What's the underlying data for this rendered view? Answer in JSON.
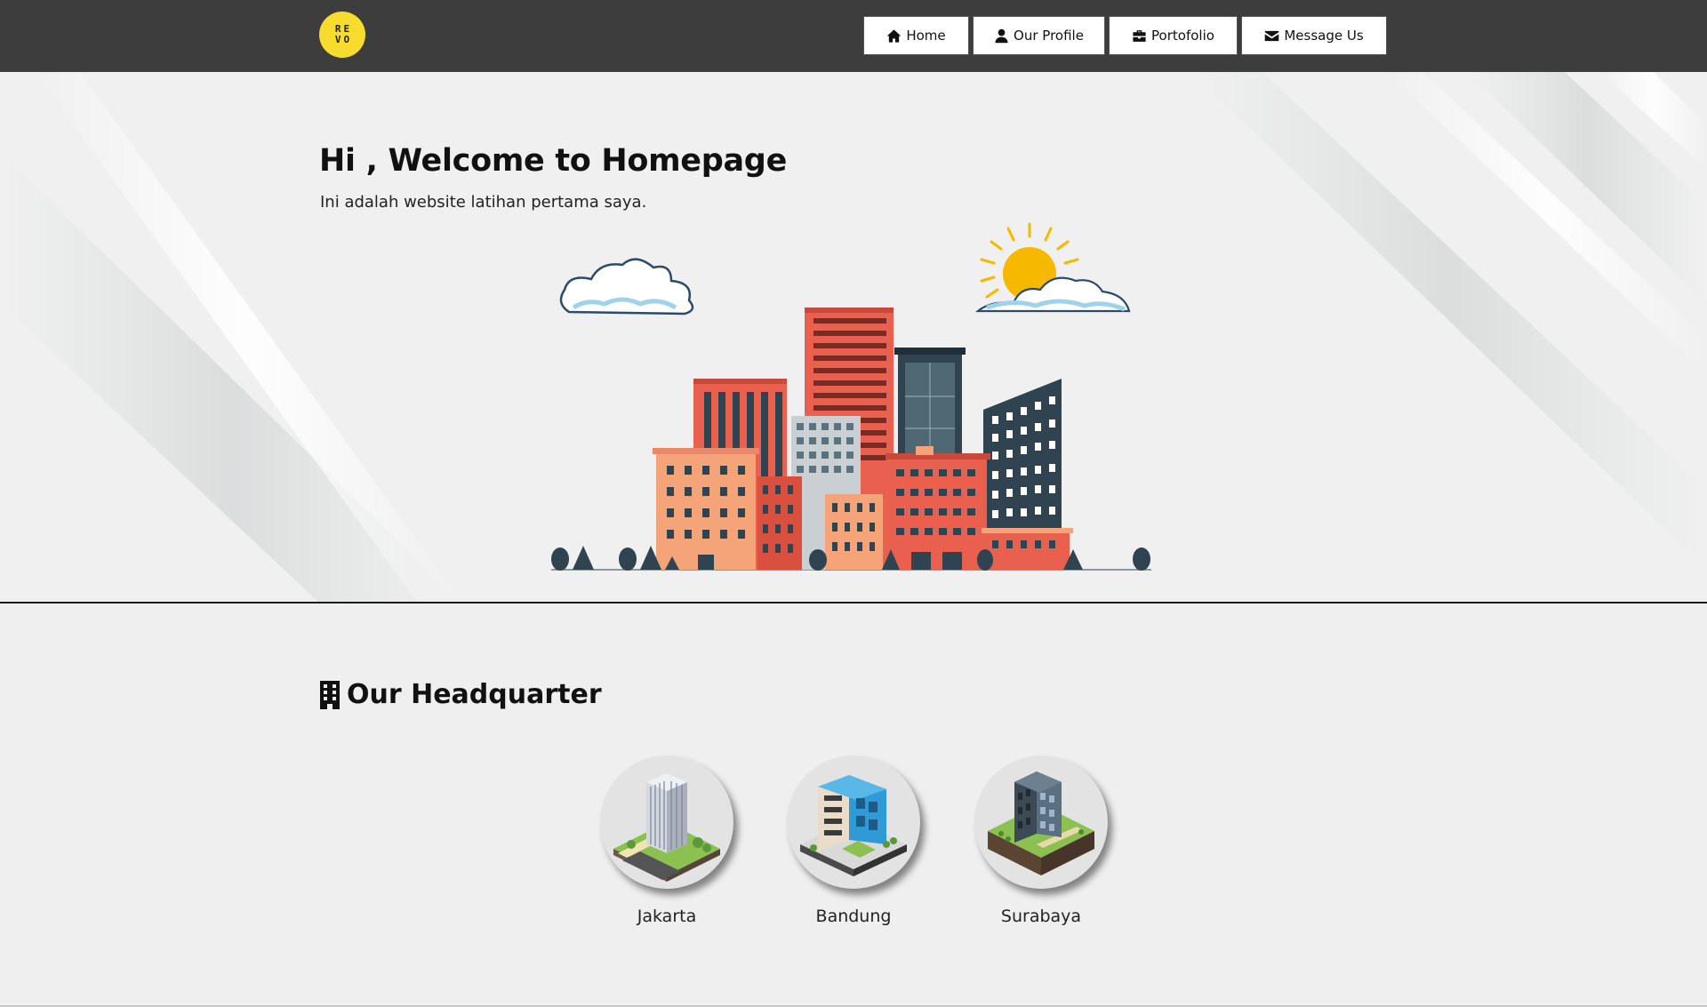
{
  "nav": {
    "logo_letters": [
      "R",
      "E",
      "V",
      "O"
    ],
    "items": [
      {
        "label": "Home",
        "icon": "home-icon"
      },
      {
        "label": "Our Profile",
        "icon": "user-icon"
      },
      {
        "label": "Portofolio",
        "icon": "briefcase-icon"
      },
      {
        "label": "Message Us",
        "icon": "envelope-icon"
      }
    ]
  },
  "hero": {
    "title": "Hi , Welcome to Homepage",
    "subtitle": "Ini adalah website latihan pertama saya."
  },
  "headquarter": {
    "title": "Our Headquarter",
    "icon": "building-icon",
    "locations": [
      {
        "name": "Jakarta"
      },
      {
        "name": "Bandung"
      },
      {
        "name": "Surabaya"
      }
    ]
  },
  "colors": {
    "navbar": "#3d3d3d",
    "logo": "#f7dc2e",
    "page_bg": "#efefef",
    "accent_brick": "#e9604e",
    "accent_dark": "#2f4450"
  }
}
